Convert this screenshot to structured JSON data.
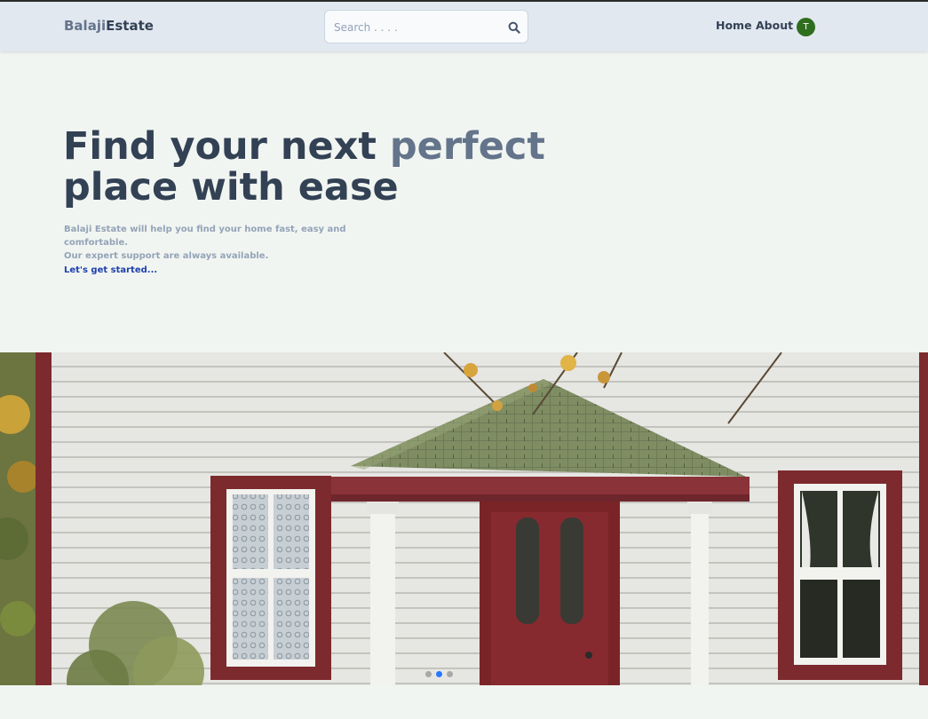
{
  "header": {
    "logo_part1": "Balaji",
    "logo_part2": "Estate",
    "search_placeholder": "Search . . . .",
    "nav_home": "Home",
    "nav_about": "About",
    "avatar_initial": "T"
  },
  "hero": {
    "title_part1": "Find your next ",
    "title_accent": "perfect",
    "title_line2": "place with ease",
    "description_line1": "Balaji Estate will help you find your home fast, easy and comfortable.",
    "description_line2": "Our expert support are always available.",
    "cta_link": "Let's get started..."
  },
  "carousel": {
    "slide_count": 3,
    "active_slide": 2
  },
  "colors": {
    "header_bg": "#e2e8f0",
    "page_bg": "#f1f5f1",
    "title_dark": "#334155",
    "title_accent": "#64748b",
    "link": "#1e40af",
    "avatar_bg": "#2f6e1f",
    "active_dot": "#2979ff"
  }
}
